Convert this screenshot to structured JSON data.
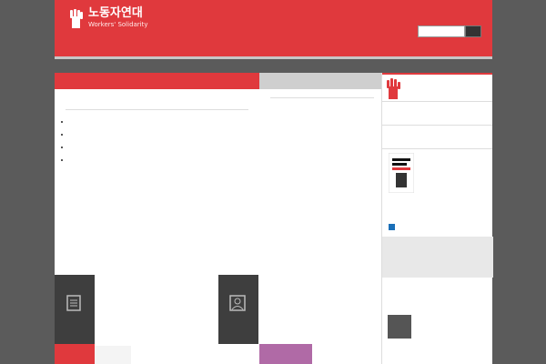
{
  "header": {
    "logo_ko": "노동자연대",
    "logo_en": "Workers' Solidarity",
    "nav": [
      "",
      "",
      "",
      "",
      ""
    ],
    "search_button": "",
    "brand_color": "#e0393d"
  },
  "col1": {
    "tab": "",
    "title": "",
    "body": "",
    "items": [
      "",
      "",
      "",
      ""
    ]
  },
  "col2": {
    "tab": "",
    "title": "",
    "desc": "",
    "links": [
      "",
      "",
      "",
      ""
    ]
  },
  "sidebar": {
    "banner": "",
    "h1": "",
    "h2": "",
    "book_tag": "",
    "book_title": "",
    "book_desc": "",
    "more": "",
    "twitter_h": "",
    "twitter_sub": "",
    "twitter_name": "",
    "twitter_text": ""
  },
  "categories": {
    "left_label": "",
    "left_items": [
      "",
      "",
      "",
      "",
      ""
    ],
    "right_label": "",
    "right_items": [
      "",
      "",
      "",
      "",
      ""
    ]
  },
  "row3": {
    "item1": "",
    "item2": ""
  }
}
